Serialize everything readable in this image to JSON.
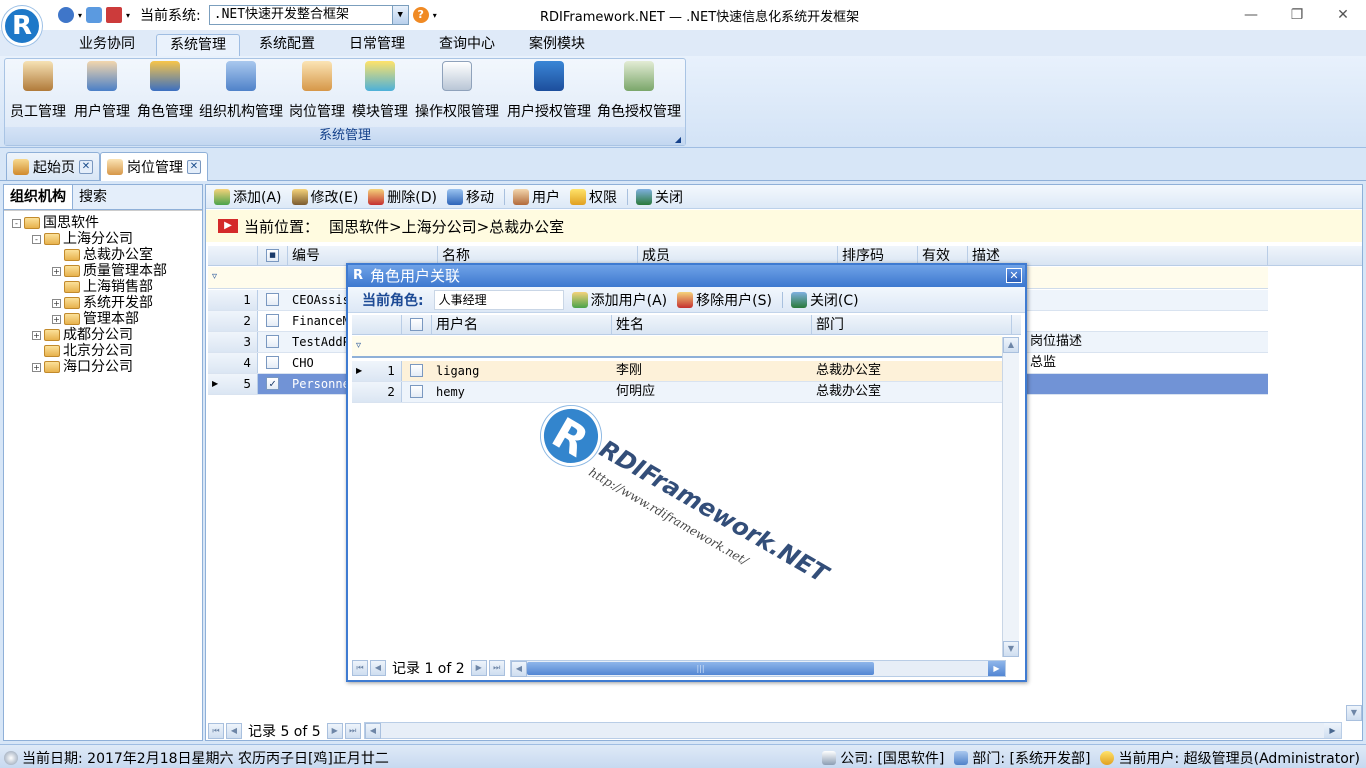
{
  "window": {
    "title": "RDIFramework.NET — .NET快速信息化系统开发框架",
    "current_system_label": "当前系统:",
    "current_system_value": ".NET快速开发整合框架",
    "help": "?"
  },
  "ribbon": {
    "tabs": [
      "业务协同",
      "系统管理",
      "系统配置",
      "日常管理",
      "查询中心",
      "案例模块"
    ],
    "active_tab": "系统管理",
    "group_caption": "系统管理",
    "buttons": [
      "员工管理",
      "用户管理",
      "角色管理",
      "组织机构管理",
      "岗位管理",
      "模块管理",
      "操作权限管理",
      "用户授权管理",
      "角色授权管理"
    ]
  },
  "doc_tabs": [
    {
      "label": "起始页",
      "icon": "home-icon"
    },
    {
      "label": "岗位管理",
      "icon": "position-icon"
    }
  ],
  "left_panel": {
    "tabs": [
      "组织机构",
      "搜索"
    ],
    "tree": [
      {
        "label": "国思软件",
        "expander": "-"
      },
      {
        "label": "上海分公司",
        "expander": "-"
      },
      {
        "label": "总裁办公室",
        "expander": ""
      },
      {
        "label": "质量管理本部",
        "expander": "+"
      },
      {
        "label": "上海销售部",
        "expander": ""
      },
      {
        "label": "系统开发部",
        "expander": "+"
      },
      {
        "label": "管理本部",
        "expander": "+"
      },
      {
        "label": "成都分公司",
        "expander": "+"
      },
      {
        "label": "北京分公司",
        "expander": ""
      },
      {
        "label": "海口分公司",
        "expander": "+"
      }
    ]
  },
  "toolbar": {
    "add": "添加(A)",
    "edit": "修改(E)",
    "delete": "删除(D)",
    "move": "移动",
    "user": "用户",
    "permission": "权限",
    "close": "关闭"
  },
  "location": {
    "label": "当前位置：",
    "path": "国思软件>上海分公司>总裁办公室"
  },
  "grid": {
    "columns": [
      "编号",
      "名称",
      "成员",
      "排序码",
      "有效",
      "描述"
    ],
    "rows": [
      {
        "num": "1",
        "code": "CEOAssis",
        "desc": "",
        "checked": false
      },
      {
        "num": "2",
        "code": "FinanceM",
        "desc": "",
        "checked": false
      },
      {
        "num": "3",
        "code": "TestAddP",
        "desc": "岗位描述",
        "checked": false
      },
      {
        "num": "4",
        "code": "CHO",
        "desc": "总监",
        "checked": false
      },
      {
        "num": "5",
        "code": "Personne",
        "desc": "",
        "checked": true
      }
    ],
    "nav_text": "记录 5 of 5"
  },
  "dialog": {
    "title": "角色用户关联",
    "role_label": "当前角色:",
    "role_value": "人事经理",
    "add_user": "添加用户(A)",
    "remove_user": "移除用户(S)",
    "close": "关闭(C)",
    "columns": [
      "用户名",
      "姓名",
      "部门"
    ],
    "rows": [
      {
        "num": "1",
        "username": "ligang",
        "name": "李刚",
        "dept": "总裁办公室"
      },
      {
        "num": "2",
        "username": "hemy",
        "name": "何明应",
        "dept": "总裁办公室"
      }
    ],
    "nav_text": "记录 1 of 2",
    "watermark_name": "RDIFramework.NET",
    "watermark_url": "http://www.rdiframework.net/"
  },
  "statusbar": {
    "date": "当前日期: 2017年2月18日星期六 农历丙子日[鸡]正月廿二",
    "company": "公司: [国思软件]",
    "department": "部门: [系统开发部]",
    "user": "当前用户: 超级管理员(Administrator)"
  },
  "colors": {
    "accent": "#3d78cf",
    "selected_row": "#7193d6",
    "location_bg": "#fffbe0"
  }
}
